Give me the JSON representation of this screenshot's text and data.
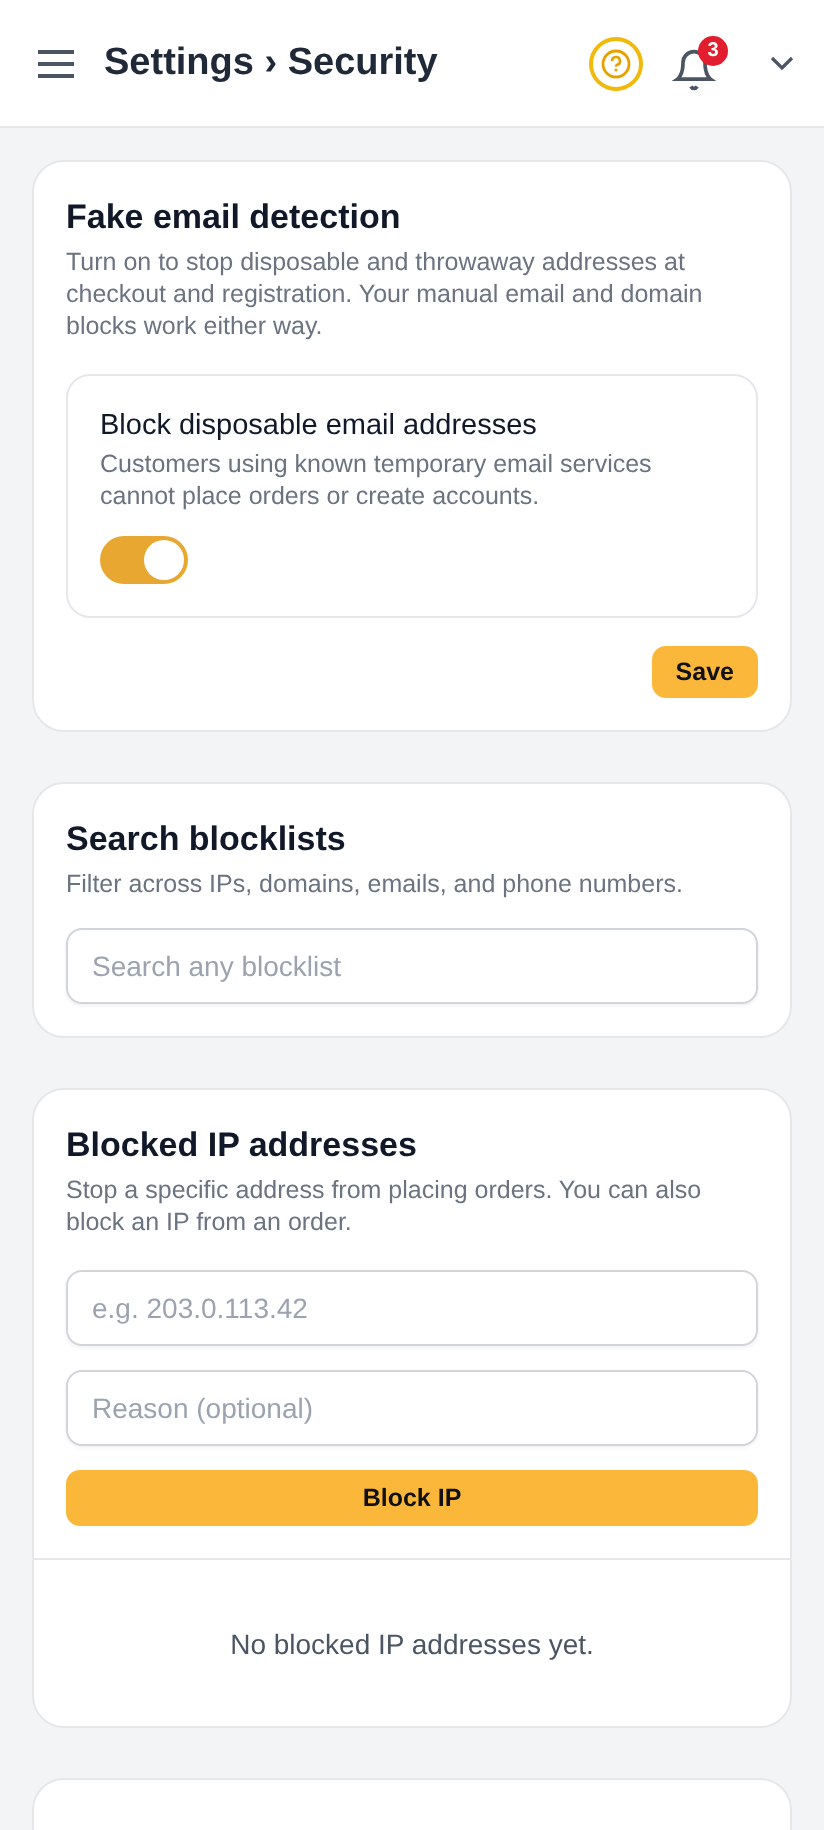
{
  "header": {
    "title": "Settings › Security",
    "notifications": "3"
  },
  "fake_email": {
    "title": "Fake email detection",
    "description": "Turn on to stop disposable and throwaway addresses at checkout and registration. Your manual email and domain blocks work either way.",
    "option": {
      "title": "Block disposable email addresses",
      "description": "Customers using known temporary email services cannot place orders or create accounts.",
      "on": true
    },
    "save": "Save"
  },
  "search": {
    "title": "Search blocklists",
    "description": "Filter across IPs, domains, emails, and phone numbers.",
    "placeholder": "Search any blocklist"
  },
  "blocked_ips": {
    "title": "Blocked IP addresses",
    "description": "Stop a specific address from placing orders. You can also block an IP from an order.",
    "ip_placeholder": "e.g. 203.0.113.42",
    "reason_placeholder": "Reason (optional)",
    "button": "Block IP",
    "empty": "No blocked IP addresses yet."
  }
}
